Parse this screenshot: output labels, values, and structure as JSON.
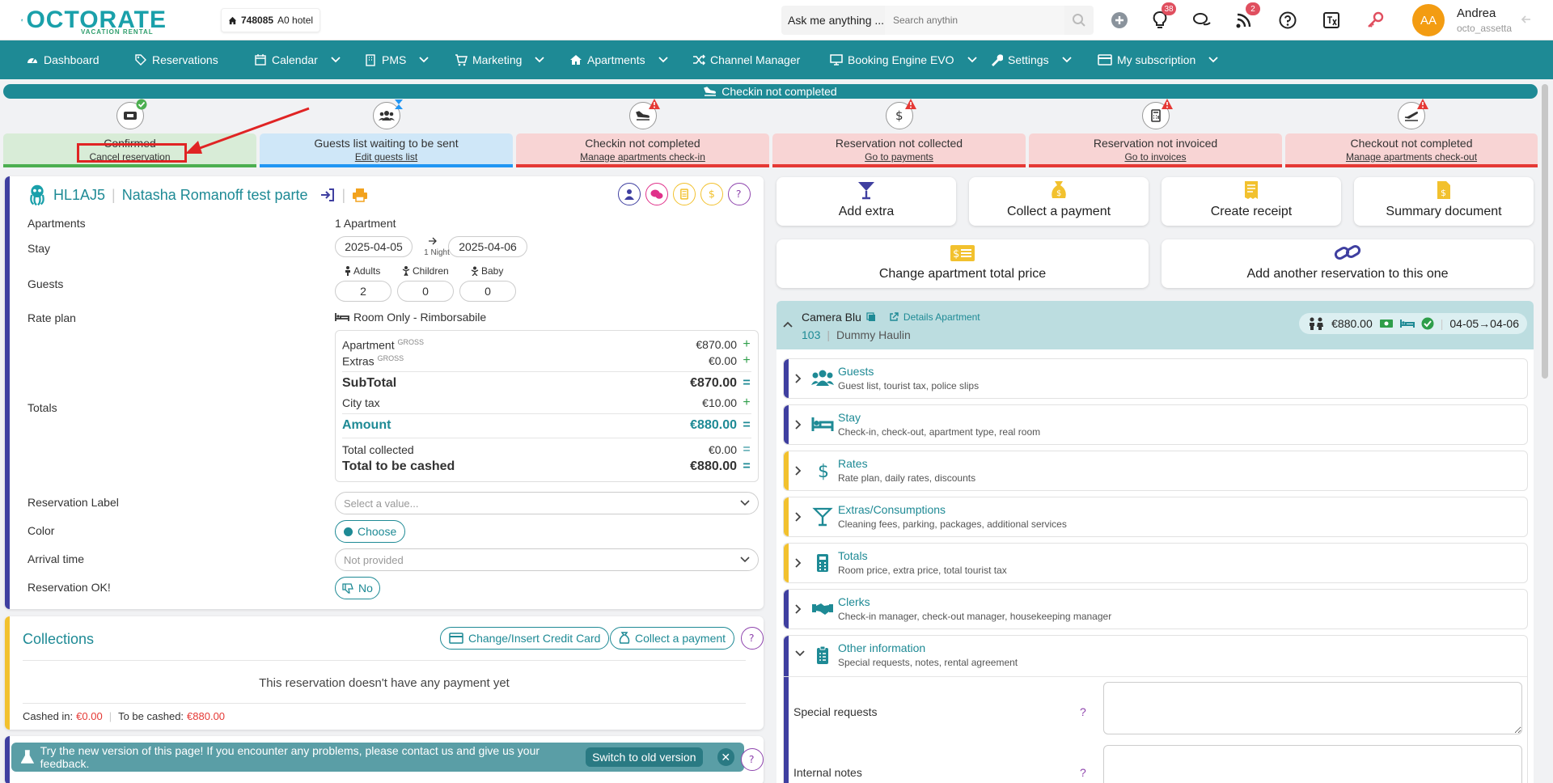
{
  "brand": {
    "logo": "OCTORATE",
    "sub": "VACATION RENTAL",
    "hotel_id": "748085",
    "hotel_name": "A0 hotel"
  },
  "search": {
    "ask": "Ask me anything ...",
    "placeholder": "Search anythin"
  },
  "badges": {
    "ideas": "38",
    "feed": "2"
  },
  "user": {
    "initials": "AA",
    "name": "Andrea",
    "login": "octo_assetta"
  },
  "nav": [
    {
      "label": "Dashboard"
    },
    {
      "label": "Reservations"
    },
    {
      "label": "Calendar"
    },
    {
      "label": "PMS"
    },
    {
      "label": "Marketing"
    },
    {
      "label": "Apartments"
    },
    {
      "label": "Channel Manager"
    },
    {
      "label": "Booking Engine EVO"
    },
    {
      "label": "Settings"
    },
    {
      "label": "My subscription"
    }
  ],
  "progress": {
    "label": "Checkin not completed"
  },
  "steps": [
    {
      "title": "Confirmed",
      "link": "Cancel reservation"
    },
    {
      "title": "Guests list waiting to be sent",
      "link": "Edit guests list"
    },
    {
      "title": "Checkin not completed",
      "link": "Manage apartments check-in"
    },
    {
      "title": "Reservation not collected",
      "link": "Go to payments"
    },
    {
      "title": "Reservation not invoiced",
      "link": "Go to invoices"
    },
    {
      "title": "Checkout not completed",
      "link": "Manage apartments check-out"
    }
  ],
  "reservation": {
    "code": "HL1AJ5",
    "guest": "Natasha Romanoff test parte",
    "labels": {
      "apartments": "Apartments",
      "stay": "Stay",
      "guests": "Guests",
      "rateplan": "Rate plan",
      "totals": "Totals",
      "reslabel": "Reservation Label",
      "color": "Color",
      "arrival": "Arrival time",
      "resok": "Reservation OK!"
    },
    "apartments": "1 Apartment",
    "checkin": "2025-04-05",
    "checkout": "2025-04-06",
    "nights": "1 Night",
    "adults_label": "Adults",
    "children_label": "Children",
    "baby_label": "Baby",
    "adults": "2",
    "children": "0",
    "baby": "0",
    "rate_plan": "Room Only - Rimborsabile",
    "totals": {
      "apartment_label": "Apartment",
      "apartment_tag": "GROSS",
      "apartment": "€870.00",
      "extras_label": "Extras",
      "extras_tag": "GROSS",
      "extras": "€0.00",
      "subtotal_label": "SubTotal",
      "subtotal": "€870.00",
      "citytax_label": "City tax",
      "citytax": "€10.00",
      "amount_label": "Amount",
      "amount": "€880.00",
      "collected_label": "Total collected",
      "collected": "€0.00",
      "tocash_label": "Total to be cashed",
      "tocash": "€880.00"
    },
    "reslabel_placeholder": "Select a value...",
    "color_btn": "Choose",
    "arrival_value": "Not provided",
    "resok_btn": "No"
  },
  "collections": {
    "title": "Collections",
    "change_card": "Change/Insert Credit Card",
    "collect": "Collect a payment",
    "empty": "This reservation doesn't have any payment yet",
    "cashed_label": "Cashed in:",
    "cashed": "€0.00",
    "tobe_label": "To be cashed:",
    "tobe": "€880.00"
  },
  "actions": {
    "add_extra": "Add extra",
    "collect": "Collect a payment",
    "receipt": "Create receipt",
    "summary": "Summary document",
    "change_price": "Change apartment total price",
    "add_res": "Add another reservation to this one"
  },
  "apartment": {
    "name": "Camera Blu",
    "details": "Details Apartment",
    "number": "103",
    "holder": "Dummy Haulin",
    "price": "€880.00",
    "dates": "04-05→04-06"
  },
  "sections": [
    {
      "title": "Guests",
      "sub": "Guest list, tourist tax, police slips"
    },
    {
      "title": "Stay",
      "sub": "Check-in, check-out, apartment type, real room"
    },
    {
      "title": "Rates",
      "sub": "Rate plan, daily rates, discounts"
    },
    {
      "title": "Extras/Consumptions",
      "sub": "Cleaning fees, parking, packages, additional services"
    },
    {
      "title": "Totals",
      "sub": "Room price, extra price, total tourist tax"
    },
    {
      "title": "Clerks",
      "sub": "Check-in manager, check-out manager, housekeeping manager"
    },
    {
      "title": "Other information",
      "sub": "Special requests, notes, rental agreement"
    }
  ],
  "other": {
    "special": "Special requests",
    "internal": "Internal notes",
    "help": "?"
  },
  "feedback": {
    "text": "Try the new version of this page! If you encounter any problems, please contact us and give us your feedback.",
    "switch": "Switch to old version",
    "close": "✕"
  },
  "colors": {
    "teal": "#1e8a95",
    "green": "#4caf50",
    "blue": "#2196f3",
    "red": "#e53935",
    "yellow": "#f2c12e",
    "purple": "#3f3fa0"
  }
}
